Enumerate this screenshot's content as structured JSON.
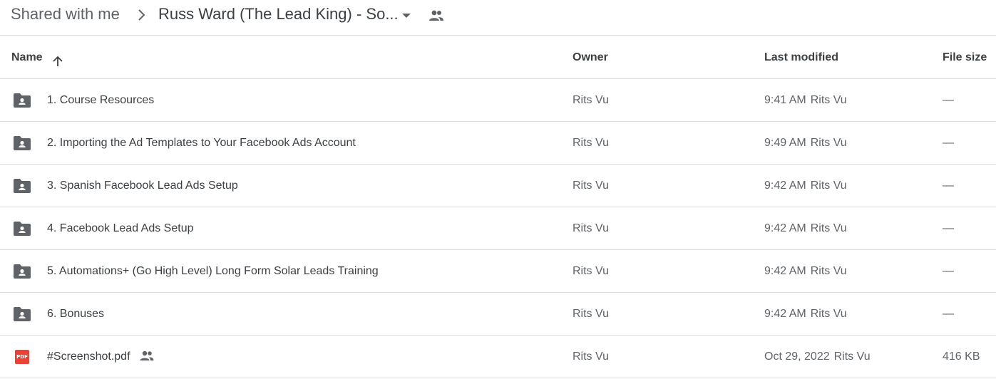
{
  "breadcrumb": {
    "root": "Shared with me",
    "current": "Russ Ward (The Lead King) - So..."
  },
  "columns": {
    "name": "Name",
    "owner": "Owner",
    "last_modified": "Last modified",
    "file_size": "File size"
  },
  "rows": [
    {
      "name": "1. Course Resources",
      "type": "shared-folder",
      "owner": "Rits Vu",
      "modified": "9:41 AM",
      "modified_by": "Rits Vu",
      "size": "—"
    },
    {
      "name": "2. Importing the Ad Templates to Your Facebook Ads Account",
      "type": "shared-folder",
      "owner": "Rits Vu",
      "modified": "9:49 AM",
      "modified_by": "Rits Vu",
      "size": "—"
    },
    {
      "name": "3. Spanish Facebook Lead Ads Setup",
      "type": "shared-folder",
      "owner": "Rits Vu",
      "modified": "9:42 AM",
      "modified_by": "Rits Vu",
      "size": "—"
    },
    {
      "name": "4. Facebook Lead Ads Setup",
      "type": "shared-folder",
      "owner": "Rits Vu",
      "modified": "9:42 AM",
      "modified_by": "Rits Vu",
      "size": "—"
    },
    {
      "name": "5. Automations+ (Go High Level) Long Form Solar Leads Training",
      "type": "shared-folder",
      "owner": "Rits Vu",
      "modified": "9:42 AM",
      "modified_by": "Rits Vu",
      "size": "—"
    },
    {
      "name": "6. Bonuses",
      "type": "shared-folder",
      "owner": "Rits Vu",
      "modified": "9:42 AM",
      "modified_by": "Rits Vu",
      "size": "—"
    },
    {
      "name": "#Screenshot.pdf",
      "type": "pdf",
      "icon_label": "PDF",
      "owner": "Rits Vu",
      "modified": "Oct 29, 2022",
      "modified_by": "Rits Vu",
      "size": "416 KB"
    }
  ],
  "colors": {
    "folder_icon": "#5f6368",
    "pdf_icon": "#ea4335",
    "divider": "#dadce0",
    "text_primary": "#3c4043",
    "text_secondary": "#5f6368"
  },
  "icons": {
    "breadcrumb_separator": "chevron-right-icon",
    "breadcrumb_menu": "caret-down-icon",
    "shared": "people-icon",
    "sort": "arrow-up-icon",
    "folder": "shared-folder-icon",
    "pdf": "pdf-file-icon"
  }
}
